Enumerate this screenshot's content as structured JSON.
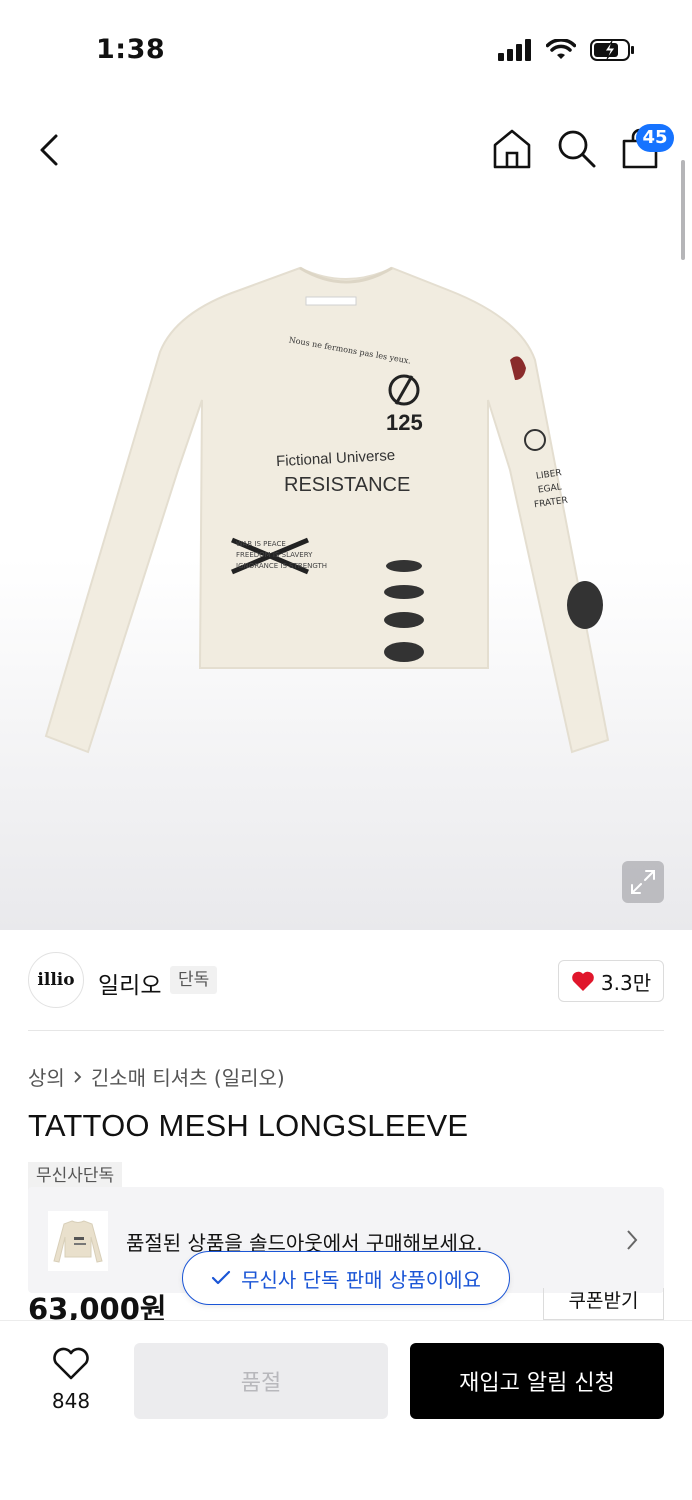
{
  "status": {
    "time": "1:38"
  },
  "nav": {
    "cart_count": "45"
  },
  "product_image": {
    "print_text": {
      "arc": "Nous ne fermons pas les yeux.",
      "number": "125",
      "line1": "Fictional Universe",
      "line2": "RESISTANCE",
      "crossed": [
        "WAR IS PEACE",
        "FREEDOM IS SLAVERY",
        "IGNORANCE IS STRENGTH"
      ],
      "sleeve": [
        "LIBER",
        "EGAL",
        "FRATER"
      ]
    },
    "accent": "#f1ece0"
  },
  "brand": {
    "logo_text": "illio",
    "name": "일리오",
    "tag": "단독",
    "likes": "3.3만"
  },
  "breadcrumb": {
    "category": "상의",
    "subcategory": "긴소매 티셔츠 (일리오)"
  },
  "product": {
    "title": "TATTOO MESH LONGSLEEVE",
    "exclusive_tag": "무신사단독",
    "price": "63,000원",
    "coupon": "쿠폰받기"
  },
  "soldout_card": {
    "text": "품절된 상품을 솔드아웃에서 구매해보세요."
  },
  "exclusive_pill": {
    "text": "무신사 단독 판매 상품이에요"
  },
  "bottom": {
    "wish_count": "848",
    "soldout_label": "품절",
    "restock_label": "재입고 알림 신청"
  },
  "colors": {
    "badge": "#1673ff",
    "pill_blue": "#1a55d6",
    "heart": "#e0162b"
  }
}
